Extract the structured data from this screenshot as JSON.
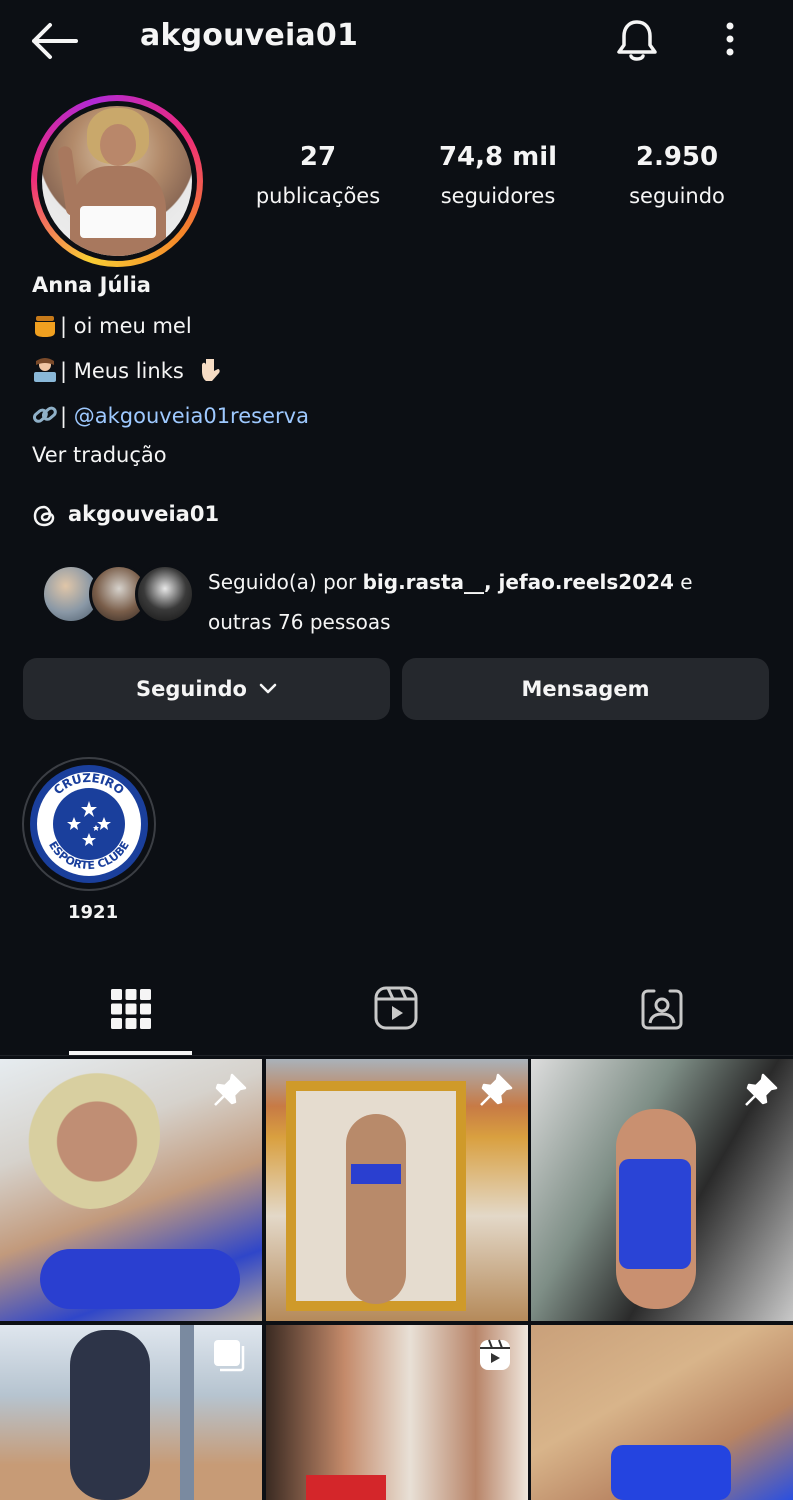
{
  "header": {
    "username": "akgouveia01",
    "back_icon": "arrow-left-icon",
    "notifications_icon": "bell-icon",
    "more_icon": "more-vertical-icon"
  },
  "stats": [
    {
      "value": "27",
      "label": "publicações"
    },
    {
      "value": "74,8 mil",
      "label": "seguidores"
    },
    {
      "value": "2.950",
      "label": "seguindo"
    }
  ],
  "bio": {
    "name": "Anna Júlia",
    "lines": [
      {
        "emoji": "honey-pot-icon",
        "text": "| oi meu mel"
      },
      {
        "emoji": "person-laptop-icon",
        "text": "| Meus links",
        "trail_emoji": "pointing-down-icon"
      },
      {
        "emoji": "link-icon",
        "prefix": "|",
        "link_text": "@akgouveia01reserva"
      }
    ],
    "translate": "Ver tradução",
    "threads_handle": "akgouveia01"
  },
  "mutuals": {
    "prefix": "Seguido(a) por ",
    "names": "big.rasta__, jefao.reels2024",
    "suffix": " e",
    "line2": "outras 76 pessoas"
  },
  "actions": {
    "following_label": "Seguindo",
    "message_label": "Mensagem"
  },
  "highlight": {
    "label": "1921",
    "badge_text_top": "CRUZEIRO",
    "badge_text_bottom": "ESPORTE CLUBE"
  },
  "tabs": [
    {
      "icon": "grid-icon",
      "active": true
    },
    {
      "icon": "reels-icon",
      "active": false
    },
    {
      "icon": "tagged-person-icon",
      "active": false
    }
  ],
  "colors": {
    "background": "#0c0f14",
    "button": "#25282d",
    "link": "#9ec9ff"
  }
}
